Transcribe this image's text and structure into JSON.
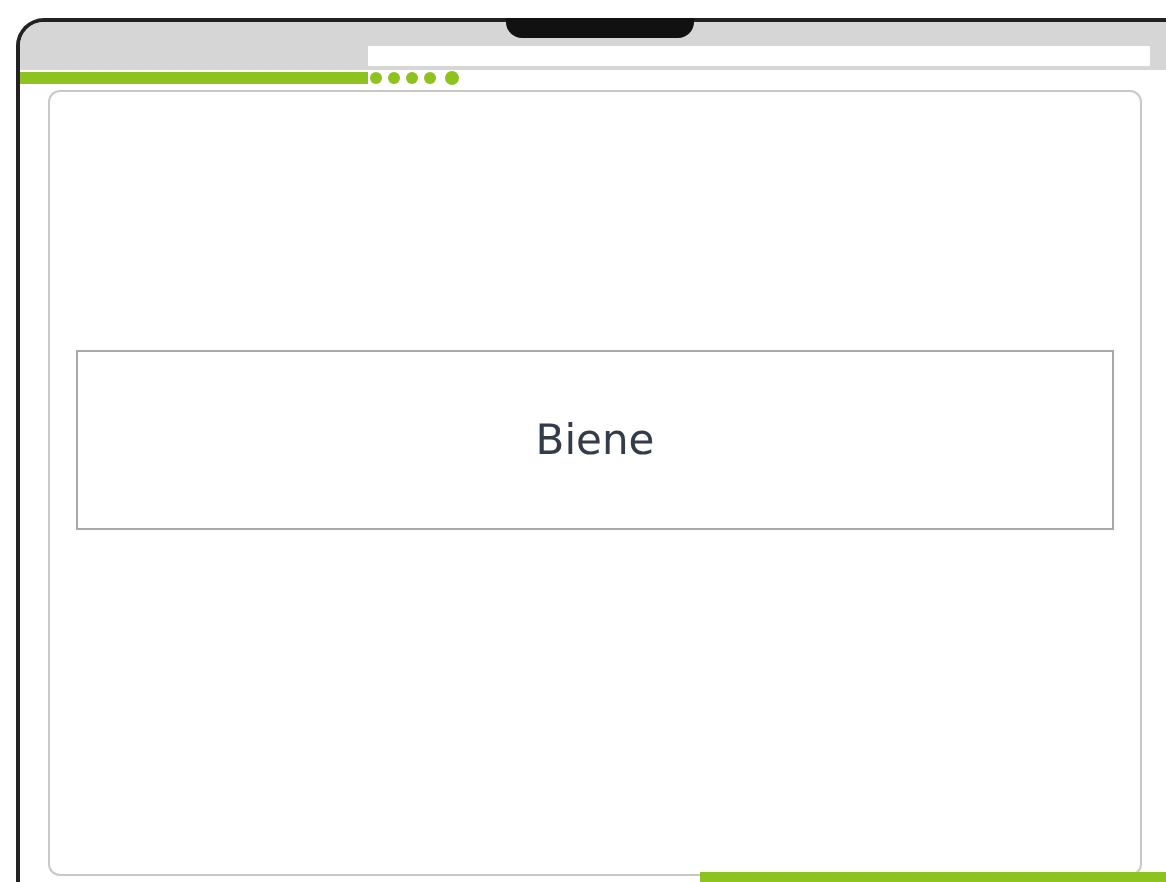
{
  "progress": {
    "level": 0.31
  },
  "card": {
    "word": "Biene"
  }
}
